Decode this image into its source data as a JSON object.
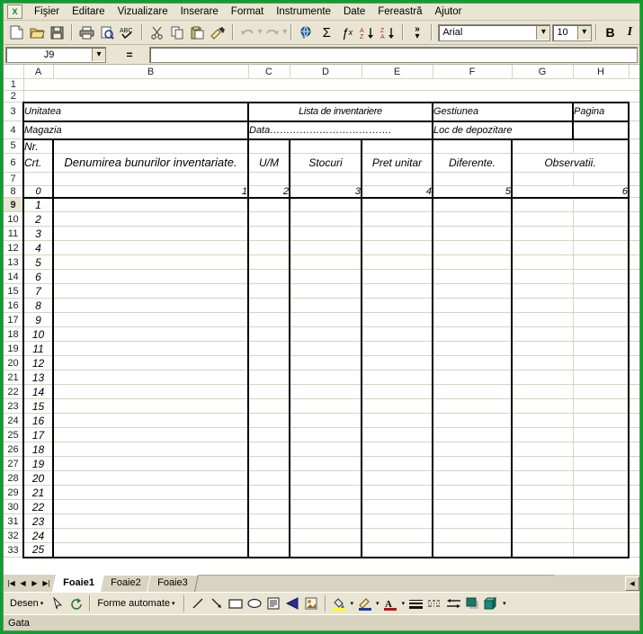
{
  "menu": {
    "items": [
      {
        "label": "Fişier"
      },
      {
        "label": "Editare"
      },
      {
        "label": "Vizualizare"
      },
      {
        "label": "Inserare"
      },
      {
        "label": "Format"
      },
      {
        "label": "Instrumente"
      },
      {
        "label": "Date"
      },
      {
        "label": "Fereastră"
      },
      {
        "label": "Ajutor"
      }
    ]
  },
  "toolbar": {
    "icons": [
      {
        "name": "new-icon"
      },
      {
        "name": "open-icon"
      },
      {
        "name": "save-icon"
      },
      {
        "name": "print-icon"
      },
      {
        "name": "print-preview-icon"
      },
      {
        "name": "spelling-icon"
      },
      {
        "name": "cut-icon"
      },
      {
        "name": "copy-icon"
      },
      {
        "name": "paste-icon"
      },
      {
        "name": "format-painter-icon"
      },
      {
        "name": "undo-icon"
      },
      {
        "name": "redo-icon"
      },
      {
        "name": "hyperlink-icon"
      },
      {
        "name": "autosum-icon"
      },
      {
        "name": "function-icon"
      },
      {
        "name": "sort-asc-icon"
      },
      {
        "name": "sort-desc-icon"
      }
    ],
    "overflow_label": "»",
    "font_name": "Arial",
    "font_size": "10",
    "bold_label": "B",
    "italic_label": "I",
    "dropdown_glyph": "▾"
  },
  "formula_bar": {
    "name_box_value": "J9",
    "equals_label": "=",
    "formula_value": ""
  },
  "grid": {
    "columns": [
      "A",
      "B",
      "C",
      "D",
      "E",
      "F",
      "G",
      "H"
    ],
    "rows": [
      "1",
      "2",
      "3",
      "4",
      "5",
      "6",
      "7",
      "8",
      "9",
      "10",
      "11",
      "12",
      "13",
      "14",
      "15",
      "16",
      "17",
      "18",
      "19",
      "20",
      "21",
      "22",
      "23",
      "24",
      "25",
      "26",
      "27",
      "28",
      "29",
      "30",
      "31",
      "32",
      "33"
    ],
    "selected_row": "9",
    "selected_cell": "J9"
  },
  "form": {
    "unitatea": "Unitatea",
    "title": "Lista de inventariere",
    "gestiunea": "Gestiunea",
    "pagina": "Pagina",
    "magazia": "Magazia",
    "data": "Data……………………………….",
    "loc_depozitare": "Loc de depozitare",
    "headers": {
      "nr": "Nr.",
      "crt": "Crt.",
      "denumirea": "Denumirea bunurilor inventariate.",
      "um": "U/M",
      "stocuri": "Stocuri",
      "pret_unitar": "Pret unitar",
      "diferente": "Diferente.",
      "observatii": "Observatii."
    },
    "number_row": [
      "0",
      "1",
      "2",
      "3",
      "4",
      "5",
      "6"
    ],
    "item_numbers": [
      "1",
      "2",
      "3",
      "4",
      "5",
      "6",
      "7",
      "8",
      "9",
      "10",
      "11",
      "12",
      "13",
      "14",
      "15",
      "16",
      "17",
      "18",
      "19",
      "20",
      "21",
      "22",
      "23",
      "24",
      "25"
    ]
  },
  "sheet_tabs": {
    "nav": [
      "|◀",
      "◀",
      "▶",
      "▶|"
    ],
    "tabs": [
      {
        "label": "Foaie1",
        "active": true
      },
      {
        "label": "Foaie2",
        "active": false
      },
      {
        "label": "Foaie3",
        "active": false
      }
    ],
    "scroll_left_glyph": "◀"
  },
  "drawing_toolbar": {
    "desen_label": "Desen",
    "forme_label": "Forme automate",
    "dropdown_glyph": "▾",
    "icons": [
      {
        "name": "select-arrow-icon"
      },
      {
        "name": "rotate-icon"
      },
      {
        "name": "line-icon"
      },
      {
        "name": "arrow-icon"
      },
      {
        "name": "rectangle-icon"
      },
      {
        "name": "oval-icon"
      },
      {
        "name": "text-box-icon"
      },
      {
        "name": "wordart-icon"
      },
      {
        "name": "clipart-icon"
      },
      {
        "name": "fill-color-icon"
      },
      {
        "name": "line-color-icon"
      },
      {
        "name": "font-color-icon"
      },
      {
        "name": "line-style-icon"
      },
      {
        "name": "dash-style-icon"
      },
      {
        "name": "arrow-style-icon"
      },
      {
        "name": "shadow-icon"
      },
      {
        "name": "three-d-icon"
      }
    ]
  },
  "status_bar": {
    "text": "Gata"
  },
  "colors": {
    "app_border": "#0aa02c",
    "toolbar_bg": "#e9e5d2",
    "grid_line": "#d6d3c0",
    "form_border": "#000000"
  }
}
